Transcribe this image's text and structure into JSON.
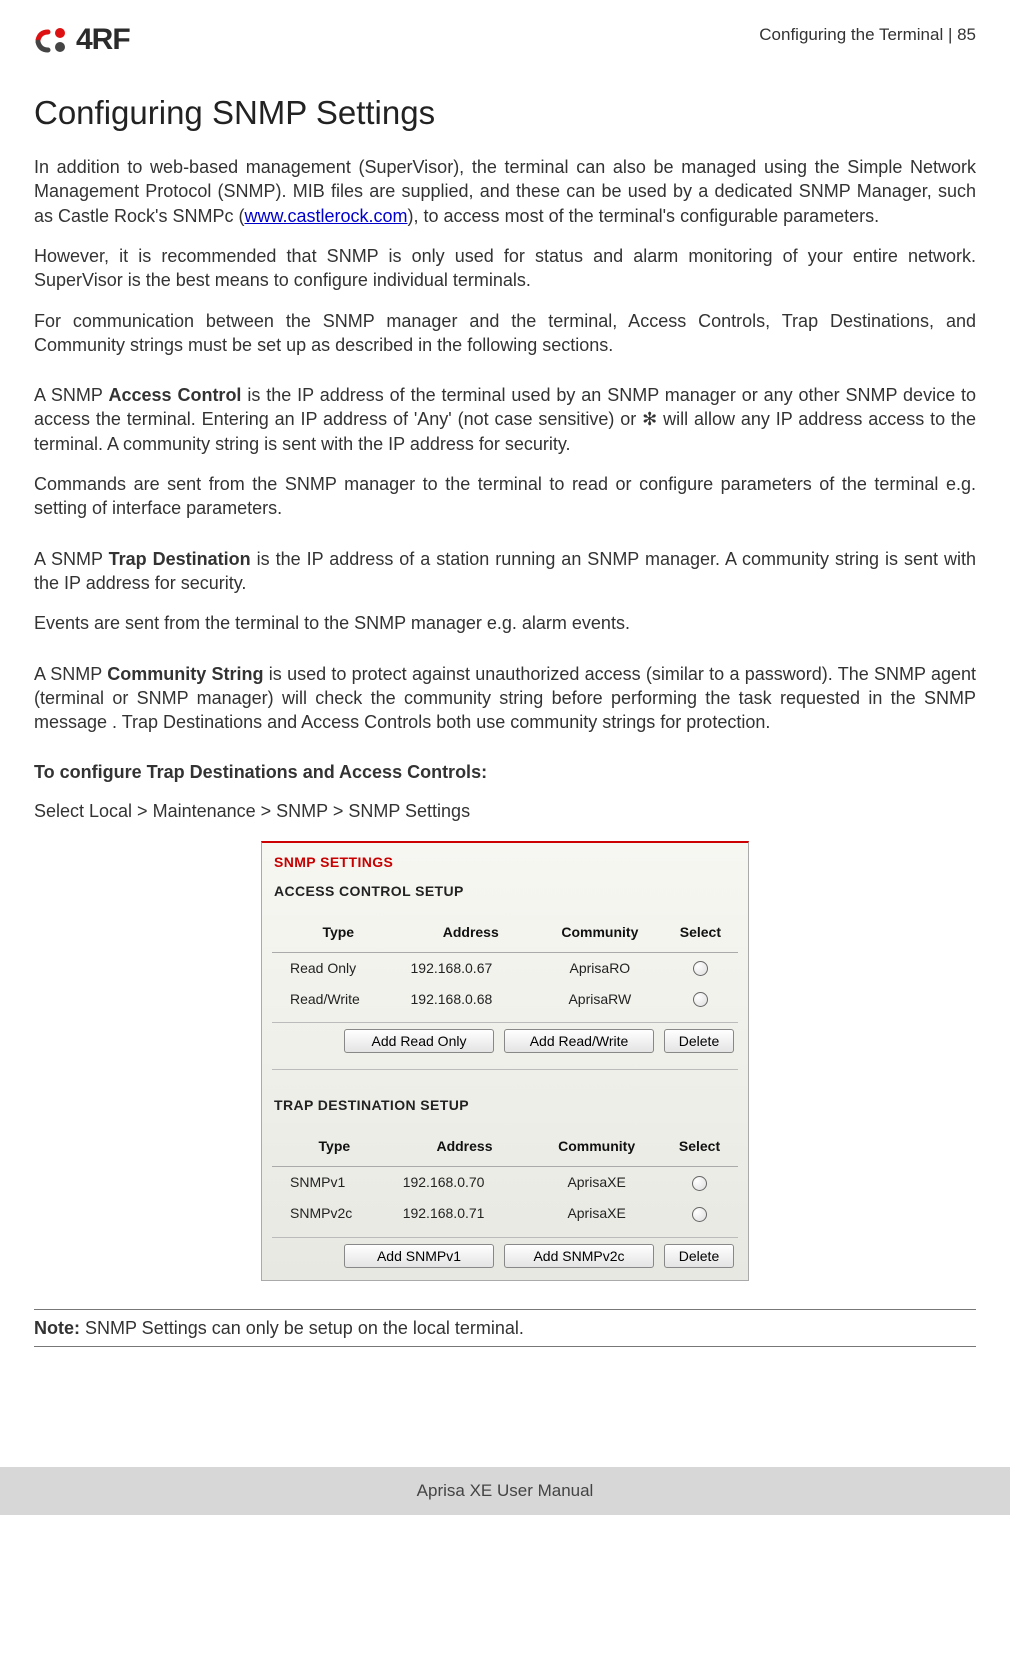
{
  "header": {
    "brand": "4RF",
    "page_label": "Configuring the Terminal  |  85"
  },
  "title": "Configuring SNMP Settings",
  "body": {
    "p1a": "In addition to web-based management (SuperVisor), the terminal can also be managed using the Simple Network Management Protocol (SNMP). MIB files are supplied, and these can be used by a dedicated SNMP Manager, such as Castle Rock's SNMPc (",
    "p1link": "www.castlerock.com",
    "p1b": "), to access most of the terminal's configurable parameters.",
    "p2": "However, it is recommended that SNMP is only used for status and alarm monitoring of your entire network. SuperVisor is the best means to configure individual terminals.",
    "p3": "For communication between the SNMP manager and the terminal, Access Controls, Trap Destinations, and Community strings must be set up as described in the following sections.",
    "p4a": "A SNMP ",
    "p4b_bold": "Access Control",
    "p4c": " is the IP address of the terminal used by an SNMP manager or any other SNMP device to access the terminal. Entering an IP address of 'Any' (not case sensitive) or ✻ will allow any IP address access to the terminal. A community string is sent with the IP address for security.",
    "p5": "Commands are sent from the SNMP manager to the terminal to read or configure parameters of the terminal e.g. setting of interface parameters.",
    "p6a": "A SNMP ",
    "p6b_bold": "Trap Destination",
    "p6c": " is the IP address of a station running an SNMP manager. A community string is sent with the IP address for security.",
    "p7": "Events are sent from the terminal to the SNMP manager e.g. alarm events.",
    "p8a": "A SNMP ",
    "p8b_bold": "Community String",
    "p8c": " is used to protect against unauthorized access (similar to a password). The SNMP agent (terminal or SNMP manager) will check the community string before performing the task requested in the SNMP message . Trap Destinations and Access Controls both use community strings for protection.",
    "cfg_heading": "To configure Trap Destinations and Access Controls:",
    "cfg_path": "Select Local > Maintenance > SNMP > SNMP Settings",
    "note_label": "Note:",
    "note_text": " SNMP Settings can only be setup on the local terminal."
  },
  "panel": {
    "title": "SNMP SETTINGS",
    "access": {
      "title": "ACCESS CONTROL SETUP",
      "cols": {
        "type": "Type",
        "address": "Address",
        "community": "Community",
        "select": "Select"
      },
      "rows": [
        {
          "type": "Read Only",
          "address": "192.168.0.67",
          "community": "AprisaRO"
        },
        {
          "type": "Read/Write",
          "address": "192.168.0.68",
          "community": "AprisaRW"
        }
      ],
      "buttons": {
        "add_ro": "Add Read Only",
        "add_rw": "Add Read/Write",
        "delete": "Delete"
      }
    },
    "trap": {
      "title": "TRAP DESTINATION SETUP",
      "cols": {
        "type": "Type",
        "address": "Address",
        "community": "Community",
        "select": "Select"
      },
      "rows": [
        {
          "type": "SNMPv1",
          "address": "192.168.0.70",
          "community": "AprisaXE"
        },
        {
          "type": "SNMPv2c",
          "address": "192.168.0.71",
          "community": "AprisaXE"
        }
      ],
      "buttons": {
        "add_v1": "Add SNMPv1",
        "add_v2c": "Add SNMPv2c",
        "delete": "Delete"
      }
    }
  },
  "footer": "Aprisa XE User Manual"
}
